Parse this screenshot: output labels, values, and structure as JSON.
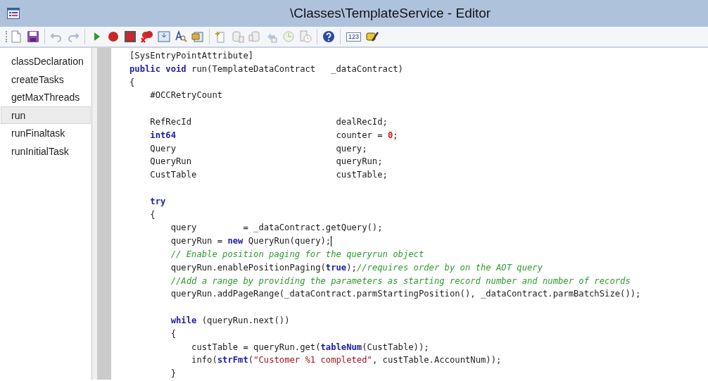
{
  "window": {
    "title": "\\Classes\\TemplateService - Editor"
  },
  "toolbar": {
    "number_button": "123"
  },
  "sidebar": {
    "items": [
      {
        "label": "classDeclaration",
        "selected": false
      },
      {
        "label": "createTasks",
        "selected": false
      },
      {
        "label": "getMaxThreads",
        "selected": false
      },
      {
        "label": "run",
        "selected": true
      },
      {
        "label": "runFinaltask",
        "selected": false
      },
      {
        "label": "runInitialTask",
        "selected": false
      }
    ]
  },
  "code": {
    "lines": [
      {
        "kind": "code",
        "cursor": false,
        "tokens": [
          {
            "kind": "plain",
            "text": "[SysEntryPointAttribute]"
          }
        ]
      },
      {
        "kind": "code",
        "cursor": false,
        "tokens": [
          {
            "kind": "keyword",
            "text": "public void"
          },
          {
            "kind": "plain",
            "text": " run(TemplateDataContract   _dataContract)"
          }
        ]
      },
      {
        "kind": "code",
        "cursor": false,
        "tokens": [
          {
            "kind": "plain",
            "text": "{"
          }
        ]
      },
      {
        "kind": "code",
        "cursor": false,
        "tokens": [
          {
            "kind": "plain",
            "text": "    #OCCRetryCount"
          }
        ]
      },
      {
        "kind": "blank"
      },
      {
        "kind": "code",
        "cursor": false,
        "tokens": [
          {
            "kind": "plain",
            "text": "    RefRecId                            dealRecId;"
          }
        ]
      },
      {
        "kind": "code",
        "cursor": false,
        "tokens": [
          {
            "kind": "keyword",
            "text": "    int64"
          },
          {
            "kind": "plain",
            "text": "                               counter = "
          },
          {
            "kind": "number",
            "text": "0"
          },
          {
            "kind": "plain",
            "text": ";"
          }
        ]
      },
      {
        "kind": "code",
        "cursor": false,
        "tokens": [
          {
            "kind": "plain",
            "text": "    Query                               query;"
          }
        ]
      },
      {
        "kind": "code",
        "cursor": false,
        "tokens": [
          {
            "kind": "plain",
            "text": "    QueryRun                            queryRun;"
          }
        ]
      },
      {
        "kind": "code",
        "cursor": false,
        "tokens": [
          {
            "kind": "plain",
            "text": "    CustTable                           custTable;"
          }
        ]
      },
      {
        "kind": "blank"
      },
      {
        "kind": "code",
        "cursor": false,
        "tokens": [
          {
            "kind": "keyword",
            "text": "    try"
          }
        ]
      },
      {
        "kind": "code",
        "cursor": false,
        "tokens": [
          {
            "kind": "plain",
            "text": "    {"
          }
        ]
      },
      {
        "kind": "code",
        "cursor": false,
        "tokens": [
          {
            "kind": "plain",
            "text": "        query         = _dataContract.getQuery();"
          }
        ]
      },
      {
        "kind": "code",
        "cursor": true,
        "tokens": [
          {
            "kind": "plain",
            "text": "        queryRun = "
          },
          {
            "kind": "keyword",
            "text": "new"
          },
          {
            "kind": "plain",
            "text": " QueryRun(query);"
          }
        ]
      },
      {
        "kind": "code",
        "cursor": false,
        "tokens": [
          {
            "kind": "comment",
            "text": "        // Enable position paging for the queryrun object"
          }
        ]
      },
      {
        "kind": "code",
        "cursor": false,
        "tokens": [
          {
            "kind": "plain",
            "text": "        queryRun.enablePositionPaging("
          },
          {
            "kind": "keyword",
            "text": "true"
          },
          {
            "kind": "plain",
            "text": ");"
          },
          {
            "kind": "comment",
            "text": "//requires order by on the AOT query"
          }
        ]
      },
      {
        "kind": "code",
        "cursor": false,
        "tokens": [
          {
            "kind": "comment",
            "text": "        //Add a range by providing the parameters as starting record number and number of records"
          }
        ]
      },
      {
        "kind": "code",
        "cursor": false,
        "tokens": [
          {
            "kind": "plain",
            "text": "        queryRun.addPageRange(_dataContract.parmStartingPosition(), _dataContract.parmBatchSize());"
          }
        ]
      },
      {
        "kind": "blank"
      },
      {
        "kind": "code",
        "cursor": false,
        "tokens": [
          {
            "kind": "keyword",
            "text": "        while"
          },
          {
            "kind": "plain",
            "text": " (queryRun.next())"
          }
        ]
      },
      {
        "kind": "code",
        "cursor": false,
        "tokens": [
          {
            "kind": "plain",
            "text": "        {"
          }
        ]
      },
      {
        "kind": "code",
        "cursor": false,
        "tokens": [
          {
            "kind": "plain",
            "text": "            custTable = queryRun.get("
          },
          {
            "kind": "keyword",
            "text": "tableNum"
          },
          {
            "kind": "plain",
            "text": "(CustTable));"
          }
        ]
      },
      {
        "kind": "code",
        "cursor": false,
        "tokens": [
          {
            "kind": "plain",
            "text": "            info("
          },
          {
            "kind": "keyword",
            "text": "strFmt"
          },
          {
            "kind": "plain",
            "text": "("
          },
          {
            "kind": "string",
            "text": "\"Customer %1 completed\""
          },
          {
            "kind": "plain",
            "text": ", custTable.AccountNum));"
          }
        ]
      },
      {
        "kind": "code",
        "cursor": false,
        "tokens": [
          {
            "kind": "plain",
            "text": "        }"
          }
        ]
      }
    ]
  }
}
